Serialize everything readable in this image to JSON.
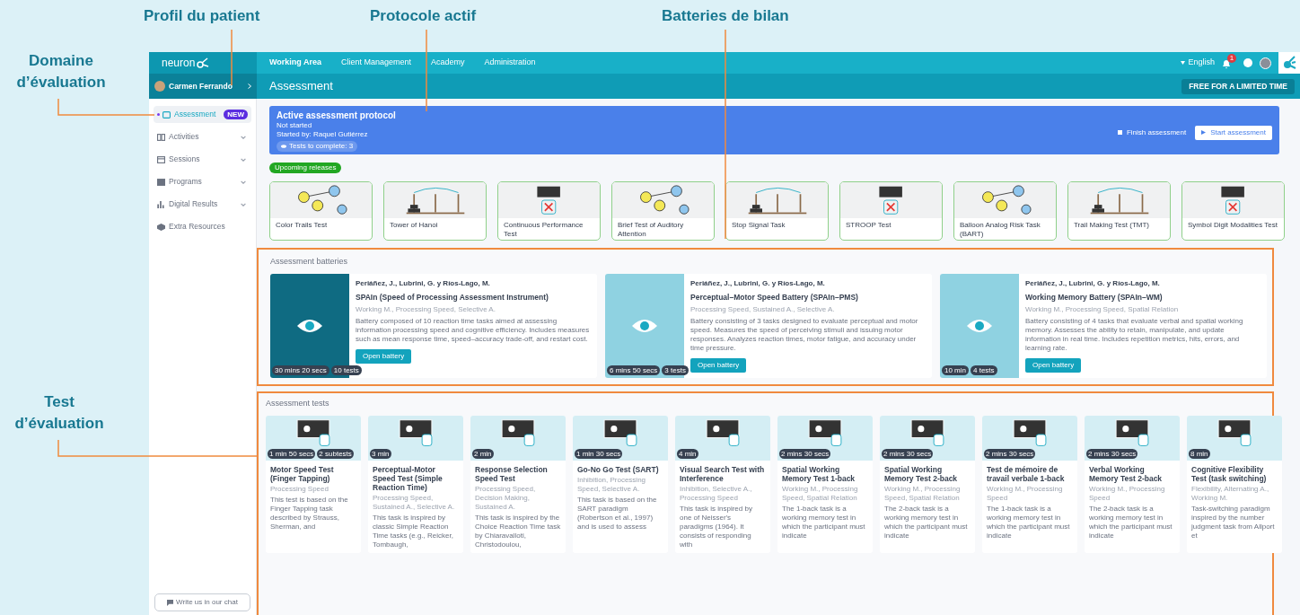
{
  "annotations": [
    {
      "text": "Profil du patient"
    },
    {
      "text": "Protocole actif"
    },
    {
      "text": "Batteries de bilan"
    },
    {
      "text": "Domaine d’évaluation"
    },
    {
      "text": "Test d’évaluation"
    }
  ],
  "top_bar": {
    "logo": "neuron",
    "nav": [
      {
        "label": "Working Area",
        "selected": true
      },
      {
        "label": "Client Management",
        "selected": false
      },
      {
        "label": "Academy",
        "selected": false
      },
      {
        "label": "Administration",
        "selected": false
      }
    ],
    "language": "English",
    "notification_count": "1"
  },
  "header": {
    "patient": "Carmen Ferrando",
    "title": "Assessment",
    "promo_button": "FREE FOR A LIMITED TIME"
  },
  "sidebar": {
    "items": [
      {
        "label": "Assessment",
        "selected": true,
        "badge": "NEW",
        "expandable": false
      },
      {
        "label": "Activities",
        "selected": false,
        "expandable": true
      },
      {
        "label": "Sessions",
        "selected": false,
        "expandable": true
      },
      {
        "label": "Programs",
        "selected": false,
        "expandable": true
      },
      {
        "label": "Digital Results",
        "selected": false,
        "expandable": true
      },
      {
        "label": "Extra Resources",
        "selected": false,
        "expandable": false
      }
    ],
    "chat_button": "Write us in our chat"
  },
  "protocol": {
    "title": "Active assessment protocol",
    "status": "Not started",
    "started_by": "Started by: Raquel Gutiérrez",
    "tests_pill": "Tests to complete: 3",
    "finish_button": "Finish assessment",
    "start_button": "Start assessment"
  },
  "upcoming": {
    "badge": "Upcoming releases",
    "tests": [
      {
        "name": "Color Trails Test"
      },
      {
        "name": "Tower of Hanoi"
      },
      {
        "name": "Continuous Performance Test"
      },
      {
        "name": "Brief Test of Auditory Attention"
      },
      {
        "name": "Stop Signal Task"
      },
      {
        "name": "STROOP Test"
      },
      {
        "name": "Balloon Analog Risk Task (BART)"
      },
      {
        "name": "Trail Making Test (TMT)"
      },
      {
        "name": "Symbol Digit Modalities Test"
      }
    ]
  },
  "batteries": {
    "title": "Assessment batteries",
    "items": [
      {
        "authors": "Periáñez, J., Lubrini, G. y Ríos-Lago, M.",
        "title": "SPAIn (Speed of Processing Assessment Instrument)",
        "tags": "Working M., Processing Speed, Selective A.",
        "description": "Battery composed of 10 reaction time tasks aimed at assessing information processing speed and cognitive efficiency. Includes measures such as mean response time, speed–accuracy trade-off, and restart cost.",
        "badges": [
          "30 mins 20 secs",
          "10 tests"
        ],
        "button": "Open battery",
        "dark": true
      },
      {
        "authors": "Periáñez, J., Lubrini, G. y Ríos-Lago, M.",
        "title": "Perceptual–Motor Speed Battery (SPAIn–PMS)",
        "tags": "Processing Speed, Sustained A., Selective A.",
        "description": "Battery consisting of 3 tasks designed to evaluate perceptual and motor speed. Measures the speed of perceiving stimuli and issuing motor responses. Analyzes reaction times, motor fatigue, and accuracy under time pressure.",
        "badges": [
          "6 mins 50 secs",
          "3 tests"
        ],
        "button": "Open battery",
        "dark": false
      },
      {
        "authors": "Periáñez, J., Lubrini, G. y Ríos-Lago, M.",
        "title": "Working Memory Battery (SPAIn–WM)",
        "tags": "Working M., Processing Speed, Spatial Relation",
        "description": "Battery consisting of 4 tasks that evaluate verbal and spatial working memory. Assesses the ability to retain, manipulate, and update information in real time. Includes repetition metrics, hits, errors, and learning rate.",
        "badges": [
          "10 min",
          "4 tests"
        ],
        "button": "Open battery",
        "dark": false
      }
    ]
  },
  "tests": {
    "title": "Assessment tests",
    "items": [
      {
        "title": "Motor Speed Test (Finger Tapping)",
        "tags": "Processing Speed",
        "description": "This test is based on the Finger Tapping task described by Strauss, Sherman, and",
        "badges": [
          "1 min 50 secs",
          "2 subtests"
        ]
      },
      {
        "title": "Perceptual-Motor Speed Test (Simple Reaction Time)",
        "tags": "Processing Speed, Sustained A., Selective A.",
        "description": "This task is inspired by classic Simple Reaction Time tasks (e.g., Reicker, Tombaugh,",
        "badges": [
          "3 min"
        ]
      },
      {
        "title": "Response Selection Speed Test",
        "tags": "Processing Speed, Decision Making, Sustained A.",
        "description": "This task is inspired by the Choice Reaction Time task by Chiaravalloti, Christodoulou,",
        "badges": [
          "2 min"
        ]
      },
      {
        "title": "Go-No Go Test (SART)",
        "tags": "Inhibition, Processing Speed, Selective A.",
        "description": "This task is based on the SART paradigm (Robertson et al., 1997) and is used to assess",
        "badges": [
          "1 min 30 secs"
        ]
      },
      {
        "title": "Visual Search Test with Interference",
        "tags": "Inhibition, Selective A., Processing Speed",
        "description": "This task is inspired by one of Neisser's paradigms (1964). It consists of responding with",
        "badges": [
          "4 min"
        ]
      },
      {
        "title": "Spatial Working Memory Test 1-back",
        "tags": "Working M., Processing Speed, Spatial Relation",
        "description": "The 1-back task is a working memory test in which the participant must indicate",
        "badges": [
          "2 mins 30 secs"
        ]
      },
      {
        "title": "Spatial Working Memory Test 2-back",
        "tags": "Working M., Processing Speed, Spatial Relation",
        "description": "The 2-back task is a working memory test in which the participant must indicate",
        "badges": [
          "2 mins 30 secs"
        ]
      },
      {
        "title": "Test de mémoire de travail verbale 1-back",
        "tags": "Working M., Processing Speed",
        "description": "The 1-back task is a working memory test in which the participant must indicate",
        "badges": [
          "2 mins 30 secs"
        ]
      },
      {
        "title": "Verbal Working Memory Test 2-back",
        "tags": "Working M., Processing Speed",
        "description": "The 2-back task is a working memory test in which the participant must indicate",
        "badges": [
          "2 mins 30 secs"
        ]
      },
      {
        "title": "Cognitive Flexibility Test (task switching)",
        "tags": "Flexibility, Alternating A., Working M.",
        "description": "Task-switching paradigm inspired by the number judgment task from Allport et",
        "badges": [
          "8 min"
        ]
      }
    ]
  }
}
